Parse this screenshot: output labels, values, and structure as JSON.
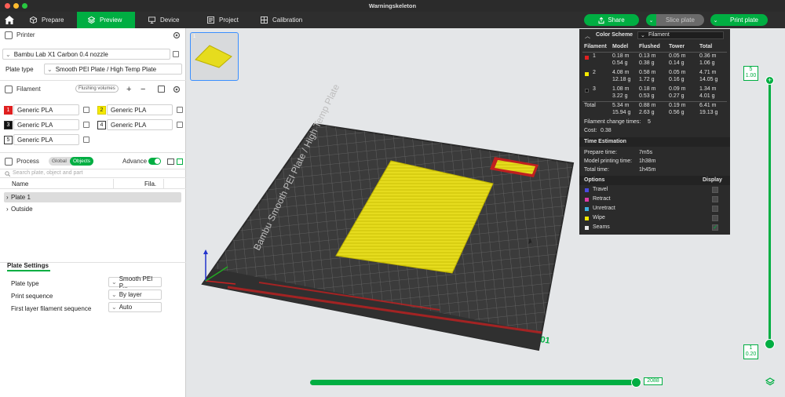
{
  "window": {
    "title": "Warningskeleton"
  },
  "nav": {
    "tabs": [
      {
        "label": "Prepare"
      },
      {
        "label": "Preview"
      },
      {
        "label": "Device"
      },
      {
        "label": "Project"
      },
      {
        "label": "Calibration"
      }
    ],
    "share_label": "Share",
    "slice_label": "Slice plate",
    "print_label": "Print plate"
  },
  "printer": {
    "section_label": "Printer",
    "name": "Bambu Lab X1 Carbon 0.4 nozzle",
    "plate_type_label": "Plate type",
    "plate_type_value": "Smooth PEI Plate / High Temp Plate"
  },
  "filament": {
    "section_label": "Filament",
    "flushing_label": "Flushing volumes",
    "items": [
      {
        "num": "1",
        "name": "Generic PLA",
        "color": "#e02020"
      },
      {
        "num": "2",
        "name": "Generic PLA",
        "color": "#f5e900"
      },
      {
        "num": "3",
        "name": "Generic PLA",
        "color": "#111111"
      },
      {
        "num": "4",
        "name": "Generic PLA",
        "color": "#ffffff"
      },
      {
        "num": "5",
        "name": "Generic PLA",
        "color": "#ffffff"
      }
    ]
  },
  "process": {
    "section_label": "Process",
    "global_label": "Global",
    "objects_label": "Objects",
    "advance_label": "Advance",
    "search_placeholder": "Search plate, object and part",
    "col_name": "Name",
    "col_fila": "Fila.",
    "tree": [
      {
        "label": "Plate 1"
      },
      {
        "label": "Outside"
      }
    ]
  },
  "plate_settings": {
    "title": "Plate Settings",
    "rows": [
      {
        "label": "Plate type",
        "value": "Smooth PEI P..."
      },
      {
        "label": "Print sequence",
        "value": "By layer"
      },
      {
        "label": "First layer filament sequence",
        "value": "Auto"
      }
    ]
  },
  "legend": {
    "scheme_label": "Color Scheme",
    "scheme_value": "Filament",
    "headers": {
      "filament": "Filament",
      "model": "Model",
      "flushed": "Flushed",
      "tower": "Tower",
      "total": "Total"
    },
    "rows": [
      {
        "num": "1",
        "color": "#e02020",
        "model": [
          "0.18 m",
          "0.54 g"
        ],
        "flushed": [
          "0.13 m",
          "0.38 g"
        ],
        "tower": [
          "0.05 m",
          "0.14 g"
        ],
        "total": [
          "0.36 m",
          "1.06 g"
        ]
      },
      {
        "num": "2",
        "color": "#f5e900",
        "model": [
          "4.08 m",
          "12.18 g"
        ],
        "flushed": [
          "0.58 m",
          "1.72 g"
        ],
        "tower": [
          "0.05 m",
          "0.16 g"
        ],
        "total": [
          "4.71 m",
          "14.05 g"
        ]
      },
      {
        "num": "3",
        "color": "#111111",
        "model": [
          "1.08 m",
          "3.22 g"
        ],
        "flushed": [
          "0.18 m",
          "0.53 g"
        ],
        "tower": [
          "0.09 m",
          "0.27 g"
        ],
        "total": [
          "1.34 m",
          "4.01 g"
        ]
      }
    ],
    "total": {
      "label": "Total",
      "model": [
        "5.34 m",
        "15.94 g"
      ],
      "flushed": [
        "0.88 m",
        "2.63 g"
      ],
      "tower": [
        "0.19 m",
        "0.56 g"
      ],
      "total": [
        "6.41 m",
        "19.13 g"
      ]
    },
    "change_times_label": "Filament change times:",
    "change_times_value": "5",
    "cost_label": "Cost:",
    "cost_value": "0.38",
    "time_title": "Time Estimation",
    "prepare_label": "Prepare time:",
    "prepare_value": "7m5s",
    "model_time_label": "Model printing time:",
    "model_time_value": "1h38m",
    "total_time_label": "Total time:",
    "total_time_value": "1h45m",
    "options_label": "Options",
    "display_label": "Display",
    "options": [
      {
        "label": "Travel",
        "color": "#4a4adf",
        "checked": false
      },
      {
        "label": "Retract",
        "color": "#df3aa8",
        "checked": false
      },
      {
        "label": "Unretract",
        "color": "#40b0e0",
        "checked": false
      },
      {
        "label": "Wipe",
        "color": "#f5e900",
        "checked": false
      },
      {
        "label": "Seams",
        "color": "#e8e8e8",
        "checked": true
      }
    ]
  },
  "plate_label": "01",
  "bed_text": "Bambu Smooth PEI Plate / High Temp Plate",
  "layer": {
    "top_num": "5",
    "top_height": "1.00",
    "bottom_num": "1",
    "bottom_height": "0.20",
    "move_value": "2088"
  }
}
